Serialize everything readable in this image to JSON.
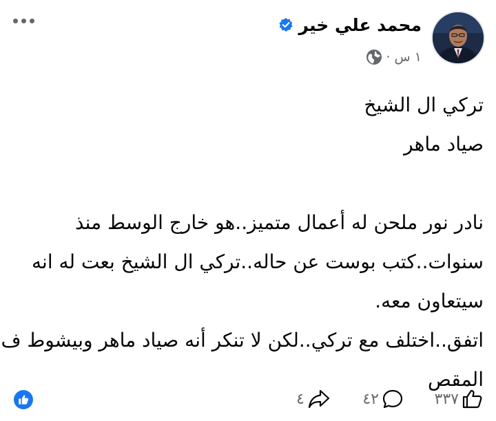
{
  "post": {
    "author": {
      "name": "محمد علي خير",
      "verified": true
    },
    "meta": {
      "time": "١ س",
      "separator": "·",
      "privacy_icon": "globe-icon"
    },
    "more_icon": "more-horizontal-icon",
    "body_lines": [
      "تركي ال الشيخ",
      "صياد ماهر",
      "",
      "نادر نور ملحن له أعمال متميز..هو خارج الوسط منذ",
      "سنوات..كتب بوست عن حاله..تركي ال الشيخ بعت له انه",
      "سيتعاون معه.",
      "اتفق..اختلف مع تركي..لكن لا تنكر أنه صياد ماهر وبيشوط ف",
      "المقص"
    ],
    "footer": {
      "reaction_icon": "like-reaction-icon",
      "likes": "٣٣٧",
      "comments": "٤٢",
      "shares": "٤"
    },
    "colors": {
      "accent": "#1877f2",
      "muted": "#65676b",
      "text": "#050505"
    }
  }
}
